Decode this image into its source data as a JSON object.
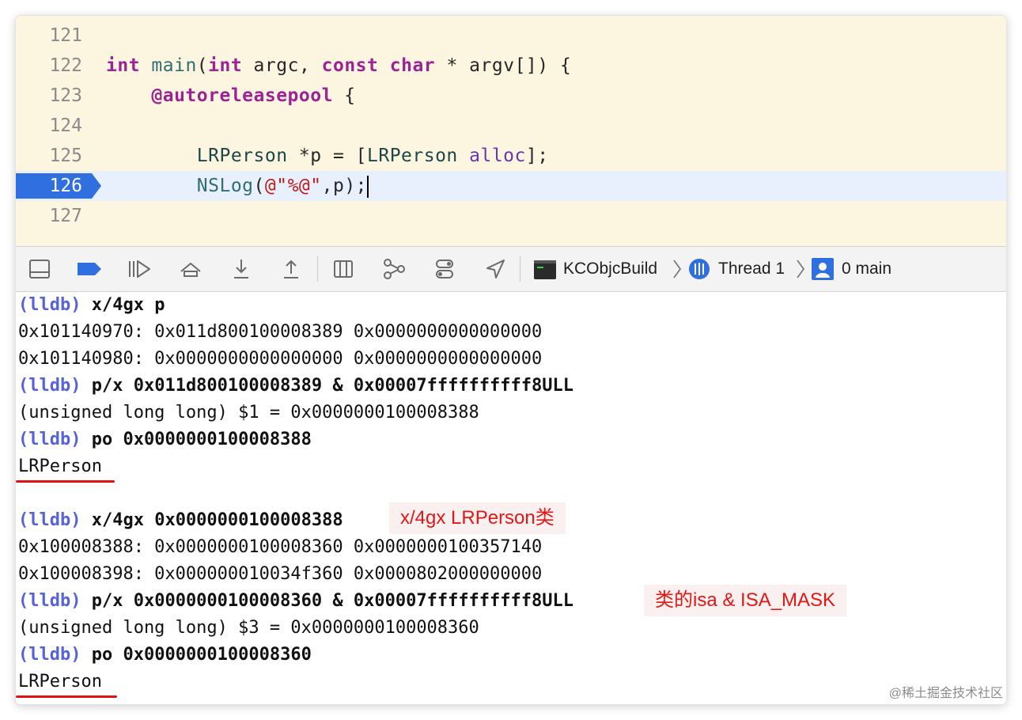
{
  "editor": {
    "line_numbers": [
      "121",
      "122",
      "123",
      "124",
      "125",
      "126",
      "127"
    ],
    "line122": {
      "kw_int": "int",
      "fn_main": "main",
      "open_paren": "(",
      "kw_int2": "int",
      "argc": " argc, ",
      "kw_const": "const",
      "space": " ",
      "kw_char": "char",
      "rest": " * argv[]) {"
    },
    "line123": {
      "kw_autoreleasepool": "@autoreleasepool",
      "rest": " {"
    },
    "line125": {
      "cls1": "LRPerson",
      "mid1": " *p = [",
      "cls2": "LRPerson",
      "space": " ",
      "msg_alloc": "alloc",
      "end": "];"
    },
    "line126": {
      "fn_nslog": "NSLog",
      "open": "(",
      "str": "@\"%@\"",
      "rest": ",p);"
    }
  },
  "debug_bar": {
    "target": "KCObjcBuild",
    "thread": "Thread 1",
    "frame": "0 main"
  },
  "console": {
    "prompt": "(lldb)",
    "lines": [
      {
        "type": "cmd",
        "text": "x/4gx p"
      },
      {
        "type": "out",
        "text": "0x101140970: 0x011d800100008389 0x0000000000000000"
      },
      {
        "type": "out",
        "text": "0x101140980: 0x0000000000000000 0x0000000000000000"
      },
      {
        "type": "cmd",
        "text": "p/x 0x011d800100008389 & 0x00007ffffffffff8ULL"
      },
      {
        "type": "out",
        "text": "(unsigned long long) $1 = 0x0000000100008388"
      },
      {
        "type": "cmd",
        "text": "po 0x0000000100008388"
      },
      {
        "type": "out",
        "text": "LRPerson"
      },
      {
        "type": "out",
        "text": ""
      },
      {
        "type": "cmd",
        "text": "x/4gx 0x0000000100008388"
      },
      {
        "type": "out",
        "text": "0x100008388: 0x0000000100008360 0x0000000100357140"
      },
      {
        "type": "out",
        "text": "0x100008398: 0x000000010034f360 0x0000802000000000"
      },
      {
        "type": "cmd",
        "text": "p/x 0x0000000100008360 & 0x00007ffffffffff8ULL"
      },
      {
        "type": "out",
        "text": "(unsigned long long) $3 = 0x0000000100008360"
      },
      {
        "type": "cmd",
        "text": "po 0x0000000100008360"
      },
      {
        "type": "out",
        "text": "LRPerson"
      }
    ]
  },
  "annotations": {
    "first": "x/4gx  LRPerson类",
    "second": "类的isa & ISA_MASK"
  },
  "watermark": "@稀土掘金技术社区",
  "colors": {
    "editor_bg": "#fcf6e1",
    "current_line_bg": "#e8f0fd",
    "breakpoint": "#2f6fe0",
    "prompt": "#5662d8",
    "annotation_text": "#e01818",
    "underline": "#e01313"
  }
}
